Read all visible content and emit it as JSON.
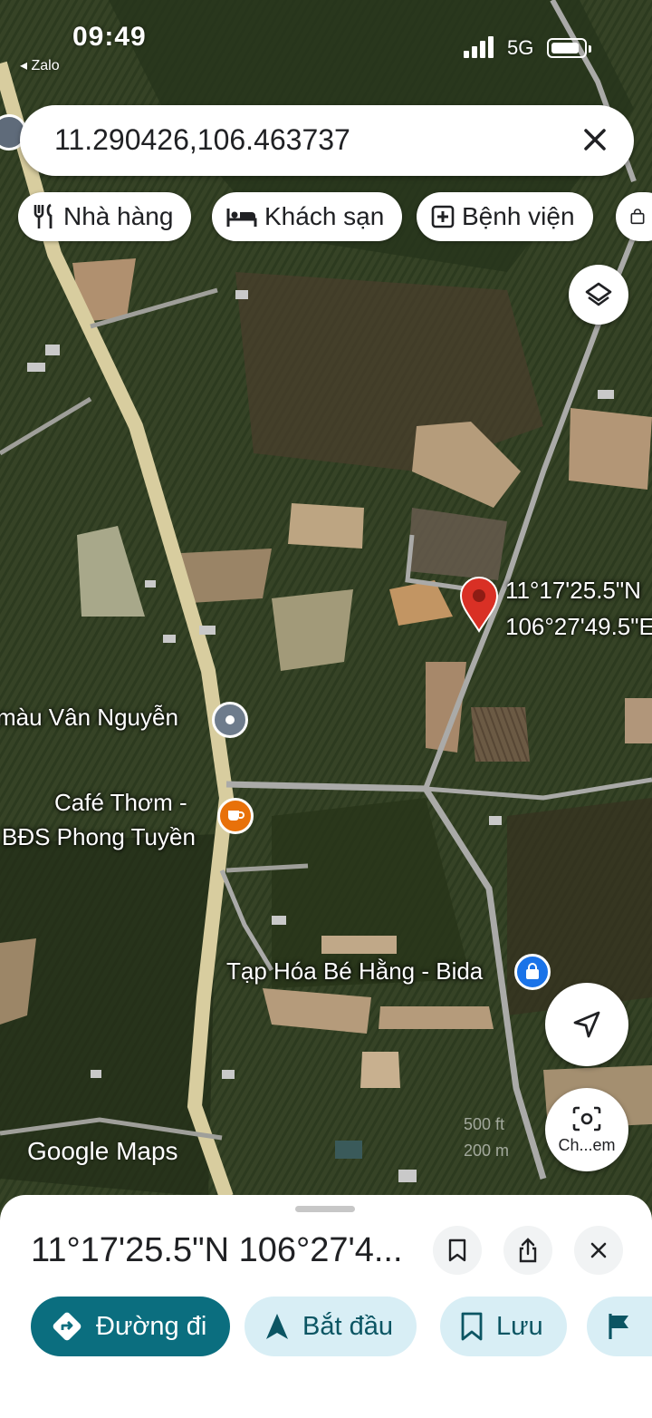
{
  "status_bar": {
    "time": "09:49",
    "back_app": "◂ Zalo",
    "network": "5G"
  },
  "search": {
    "query": "11.290426,106.463737"
  },
  "chips": [
    {
      "label": "Nhà hàng",
      "icon": "restaurant-icon"
    },
    {
      "label": "Khách sạn",
      "icon": "hotel-icon"
    },
    {
      "label": "Bệnh viện",
      "icon": "hospital-icon"
    },
    {
      "label": "",
      "icon": "shopping-bag-icon"
    }
  ],
  "map": {
    "pin_coords_line1": "11°17'25.5\"N",
    "pin_coords_line2": "106°27'49.5\"E",
    "poi_labels": {
      "van_nguyen": "màu Vân Nguyễn",
      "cafe_line1": "Café Thơm -",
      "cafe_line2": "BĐS Phong Tuyền",
      "tap_hoa": "Tạp Hóa Bé Hằng - Bida"
    },
    "scale_top": "500 ft",
    "scale_bottom": "200 m",
    "branding": "Google Maps",
    "camera_label": "Ch...em"
  },
  "sheet": {
    "title": "11°17'25.5\"N 106°27'4...",
    "actions": [
      {
        "label": "Đường đi",
        "icon": "directions-icon",
        "style": "primary"
      },
      {
        "label": "Bắt đầu",
        "icon": "navigation-arrow-icon",
        "style": "secondary"
      },
      {
        "label": "Lưu",
        "icon": "bookmark-icon",
        "style": "secondary"
      },
      {
        "label": "",
        "icon": "flag-icon",
        "style": "secondary"
      }
    ]
  },
  "colors": {
    "accent": "#0b6e7f",
    "pin": "#d93025",
    "chip_bg": "#ffffff",
    "sheet_btn_bg": "#d8eef5"
  }
}
